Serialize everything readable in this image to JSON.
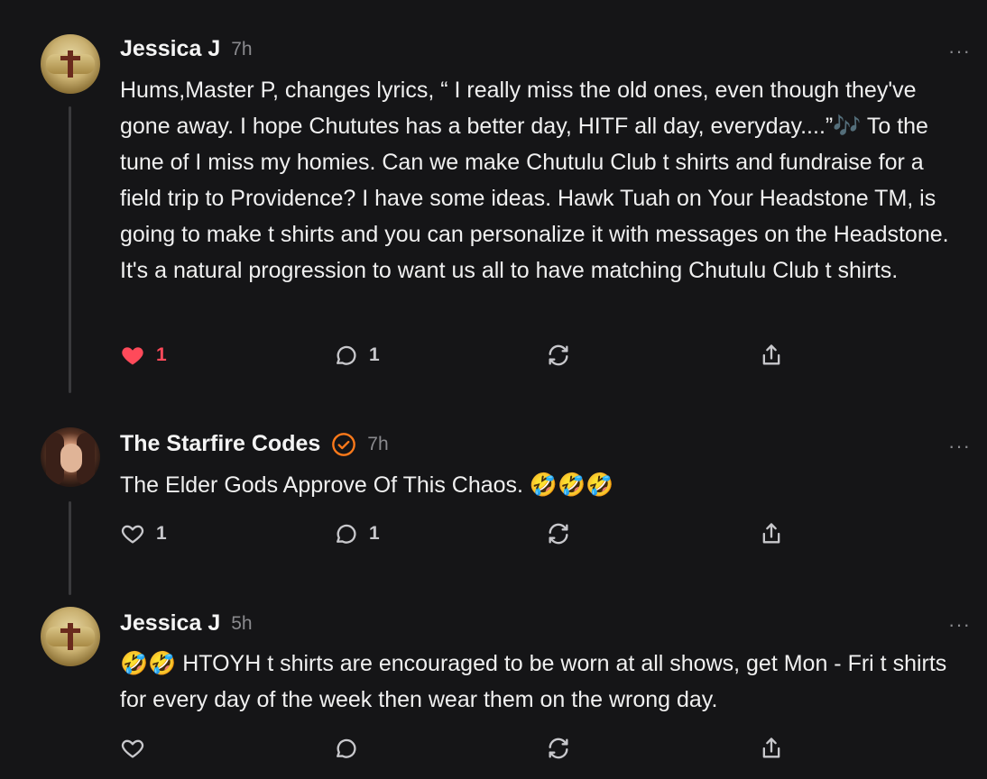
{
  "comments": [
    {
      "author": "Jessica J",
      "time": "7h",
      "text": "Hums,Master P, changes lyrics, “ I really miss the old ones, even though they've gone away. I hope Chututes has a better day, HITF all day, everyday....”🎶 To the tune of I miss my homies. Can we make Chutulu Club t shirts and fundraise for a field trip to Providence? I have some ideas. Hawk Tuah on Your Headstone TM, is going to make t shirts and you can personalize it with messages on the Headstone. It's a natural progression to want us all to have matching Chutulu Club t shirts.",
      "likes": "1",
      "liked": true,
      "replies": "1",
      "more": "···"
    },
    {
      "author": "The Starfire Codes",
      "verified": true,
      "time": "7h",
      "text": "The Elder Gods Approve Of This Chaos. 🤣🤣🤣",
      "likes": "1",
      "liked": false,
      "replies": "1",
      "more": "···"
    },
    {
      "author": "Jessica J",
      "time": "5h",
      "text": "🤣🤣 HTOYH t shirts are encouraged to be worn at all shows, get Mon - Fri t shirts for every day of the week then wear them on the wrong day.",
      "likes": "",
      "liked": false,
      "replies": "",
      "more": "···"
    }
  ],
  "icons": {
    "like": "heart-icon",
    "reply": "comment-bubble-icon",
    "restack": "restack-icon",
    "share": "share-icon",
    "verified": "verified-check-icon"
  },
  "colors": {
    "background": "#151517",
    "liked": "#ff4a5a",
    "verified": "#ff7a1a",
    "muted": "#8a8a8e"
  }
}
